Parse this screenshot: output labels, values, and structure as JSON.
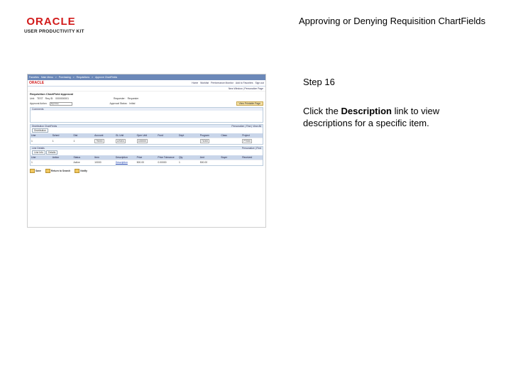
{
  "header": {
    "logo_wordmark": "ORACLE",
    "logo_subtitle": "USER PRODUCTIVITY KIT",
    "doc_title": "Approving or Denying Requisition ChartFields"
  },
  "step": {
    "label": "Step 16",
    "instruction_prefix": "Click the ",
    "instruction_link": "Description",
    "instruction_suffix": " link to view descriptions for a specific item."
  },
  "screenshot": {
    "topbar_items": [
      "Favorites",
      "Main Menu",
      ">",
      "Purchasing",
      ">",
      "Requisitions",
      ">",
      "Approve ChartFields"
    ],
    "brand": "ORACLE",
    "nav_links": [
      "Home",
      "Worklist",
      "Performance Monitor",
      "Add to Favorites",
      "Sign out"
    ],
    "new_window": "New Window | Personalize Page",
    "page_title": "Requisition ChartField Approval",
    "unit_label": "Unit:",
    "unit_value": "TEST",
    "req_id_label": "Req ID:",
    "req_id_value": "0000000001",
    "requester_label": "Requester:",
    "requester_value": "Requester",
    "approval_action_label": "Approval Action:",
    "approval_action_value": "Approve",
    "approval_status_label": "Approval Status:",
    "approval_status_value": "Initial",
    "view_btn": "View Printable Page",
    "comments_caption": "Comments",
    "dist_caption": "Distribution ChartFields",
    "dist_nav": "Personalize | Find | View All",
    "dist_tab": "Distribution",
    "dist_headers": [
      "Line",
      "Sched",
      "Dist",
      "Account",
      "GL Unit",
      "Oper Unit",
      "Fund",
      "Dept",
      "Program",
      "Class",
      "Project"
    ],
    "dist_row": [
      "1",
      "1",
      "1",
      "75000",
      "US001",
      "100000",
      "",
      "",
      "71000",
      "",
      "P7000"
    ],
    "lines_caption": "Line Details",
    "lines_nav": "Personalize | Find",
    "lines_tabs": [
      "Line Info",
      "Details"
    ],
    "lines_headers": [
      "Line",
      "Action",
      "Status",
      "Item",
      "Description",
      "Price",
      "Price Tolerance",
      "Qty",
      "Amt",
      "Buyer",
      "Received"
    ],
    "lines_row": [
      "1",
      "",
      "Active",
      "10000",
      "Description",
      "500.00",
      "0.00000",
      "1",
      "500.00",
      "",
      ""
    ],
    "footer_buttons": [
      "Save",
      "Return to Search",
      "Notify"
    ]
  }
}
